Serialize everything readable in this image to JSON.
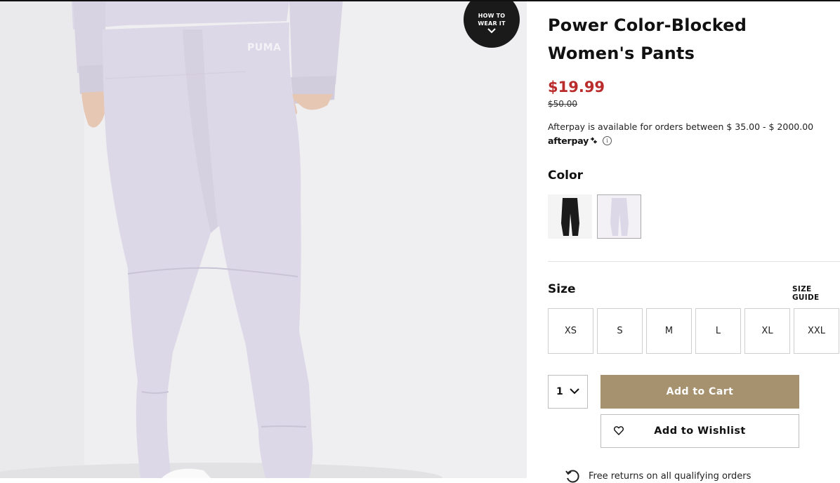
{
  "product": {
    "title": "Power Color-Blocked Women's Pants",
    "sale_price": "$19.99",
    "original_price": "$50.00",
    "brand_mark": "PUMA"
  },
  "how_to_wear": {
    "line1": "HOW TO",
    "line2": "WEAR IT"
  },
  "afterpay": {
    "text": "Afterpay is available for orders between $ 35.00 - $ 2000.00",
    "logo": "afterpay",
    "info_symbol": "i"
  },
  "color": {
    "label": "Color",
    "swatches": [
      {
        "name": "black",
        "color": "#1b1b1b"
      },
      {
        "name": "lavender",
        "color": "#ddd8e7"
      }
    ]
  },
  "size": {
    "label": "Size",
    "guide": "SIZE GUIDE",
    "options": [
      "XS",
      "S",
      "M",
      "L",
      "XL",
      "XXL"
    ]
  },
  "quantity": {
    "value": "1"
  },
  "actions": {
    "add_to_cart": "Add to Cart",
    "add_to_wishlist": "Add to Wishlist"
  },
  "returns": {
    "text": "Free returns on all qualifying orders"
  },
  "colors": {
    "sale": "#ba2b2b",
    "cart_button": "#a6926f",
    "pants": "#ddd8e7"
  }
}
